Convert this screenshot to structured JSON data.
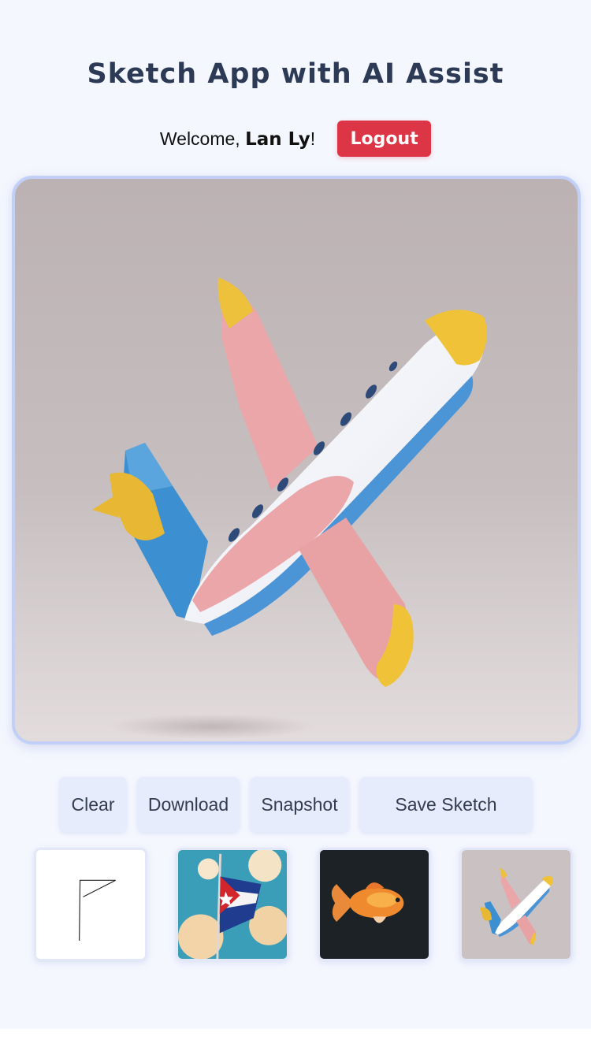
{
  "header": {
    "title": "Sketch App with AI Assist",
    "welcome_prefix": "Welcome, ",
    "user_name": "Lan Ly",
    "welcome_suffix": "!",
    "logout_label": "Logout"
  },
  "canvas": {
    "image_subject": "toy-airplane-render"
  },
  "toolbar": {
    "clear_label": "Clear",
    "download_label": "Download",
    "snapshot_label": "Snapshot",
    "save_label": "Save Sketch"
  },
  "thumbnails": [
    {
      "subject": "flag-sketch"
    },
    {
      "subject": "cuban-flag-clouds"
    },
    {
      "subject": "goldfish"
    },
    {
      "subject": "toy-airplane"
    }
  ],
  "colors": {
    "logout": "#dc3545",
    "canvas_border": "#c2d0f7",
    "tool_button_bg": "#e6ecfb",
    "title": "#2c3a55"
  }
}
